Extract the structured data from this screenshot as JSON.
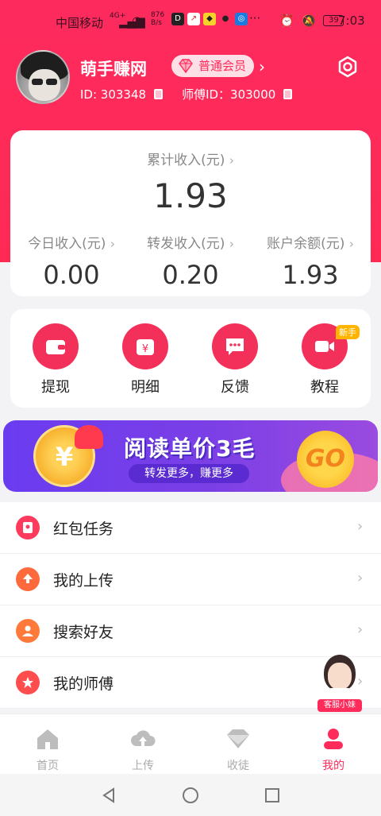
{
  "status_bar": {
    "carrier": "中国移动",
    "network": "4G+",
    "speed_value": "876",
    "speed_unit": "B/s",
    "battery": "39",
    "time": "7:03",
    "more": "···"
  },
  "profile": {
    "nickname": "萌手赚网",
    "level_badge": "普通会员",
    "id_text": "ID: 303348",
    "master_id_text": "师傅ID：303000"
  },
  "earnings": {
    "total_label": "累计收入(元)",
    "total_value": "1.93",
    "today_label": "今日收入(元)",
    "today_value": "0.00",
    "share_label": "转发收入(元)",
    "share_value": "0.20",
    "balance_label": "账户余额(元)",
    "balance_value": "1.93"
  },
  "actions": [
    {
      "label": "提现",
      "icon": "wallet-icon"
    },
    {
      "label": "明细",
      "icon": "calendar-yen-icon"
    },
    {
      "label": "反馈",
      "icon": "chat-bubble-icon"
    },
    {
      "label": "教程",
      "icon": "video-camera-icon"
    }
  ],
  "new_tag": "新手",
  "banner": {
    "headline": "阅读单价3毛",
    "subline": "转发更多，赚更多",
    "coin_symbol": "¥",
    "go_label": "GO"
  },
  "menu": [
    {
      "label": "红包任务",
      "icon": "red-envelope-icon",
      "color": "#ff3a5c"
    },
    {
      "label": "我的上传",
      "icon": "upload-icon",
      "color": "#ff6a3d"
    },
    {
      "label": "搜索好友",
      "icon": "user-icon",
      "color": "#ff7a3a"
    },
    {
      "label": "我的师傅",
      "icon": "star-icon",
      "color": "#ff4d4d"
    }
  ],
  "service_label": "客服小妹",
  "tabs": [
    {
      "label": "首页",
      "icon": "home-icon"
    },
    {
      "label": "上传",
      "icon": "cloud-upload-icon"
    },
    {
      "label": "收徒",
      "icon": "diamond-icon"
    },
    {
      "label": "我的",
      "icon": "person-icon"
    }
  ],
  "colors": {
    "brand": "#ff2b5b",
    "banner": "#7b3fe6"
  }
}
